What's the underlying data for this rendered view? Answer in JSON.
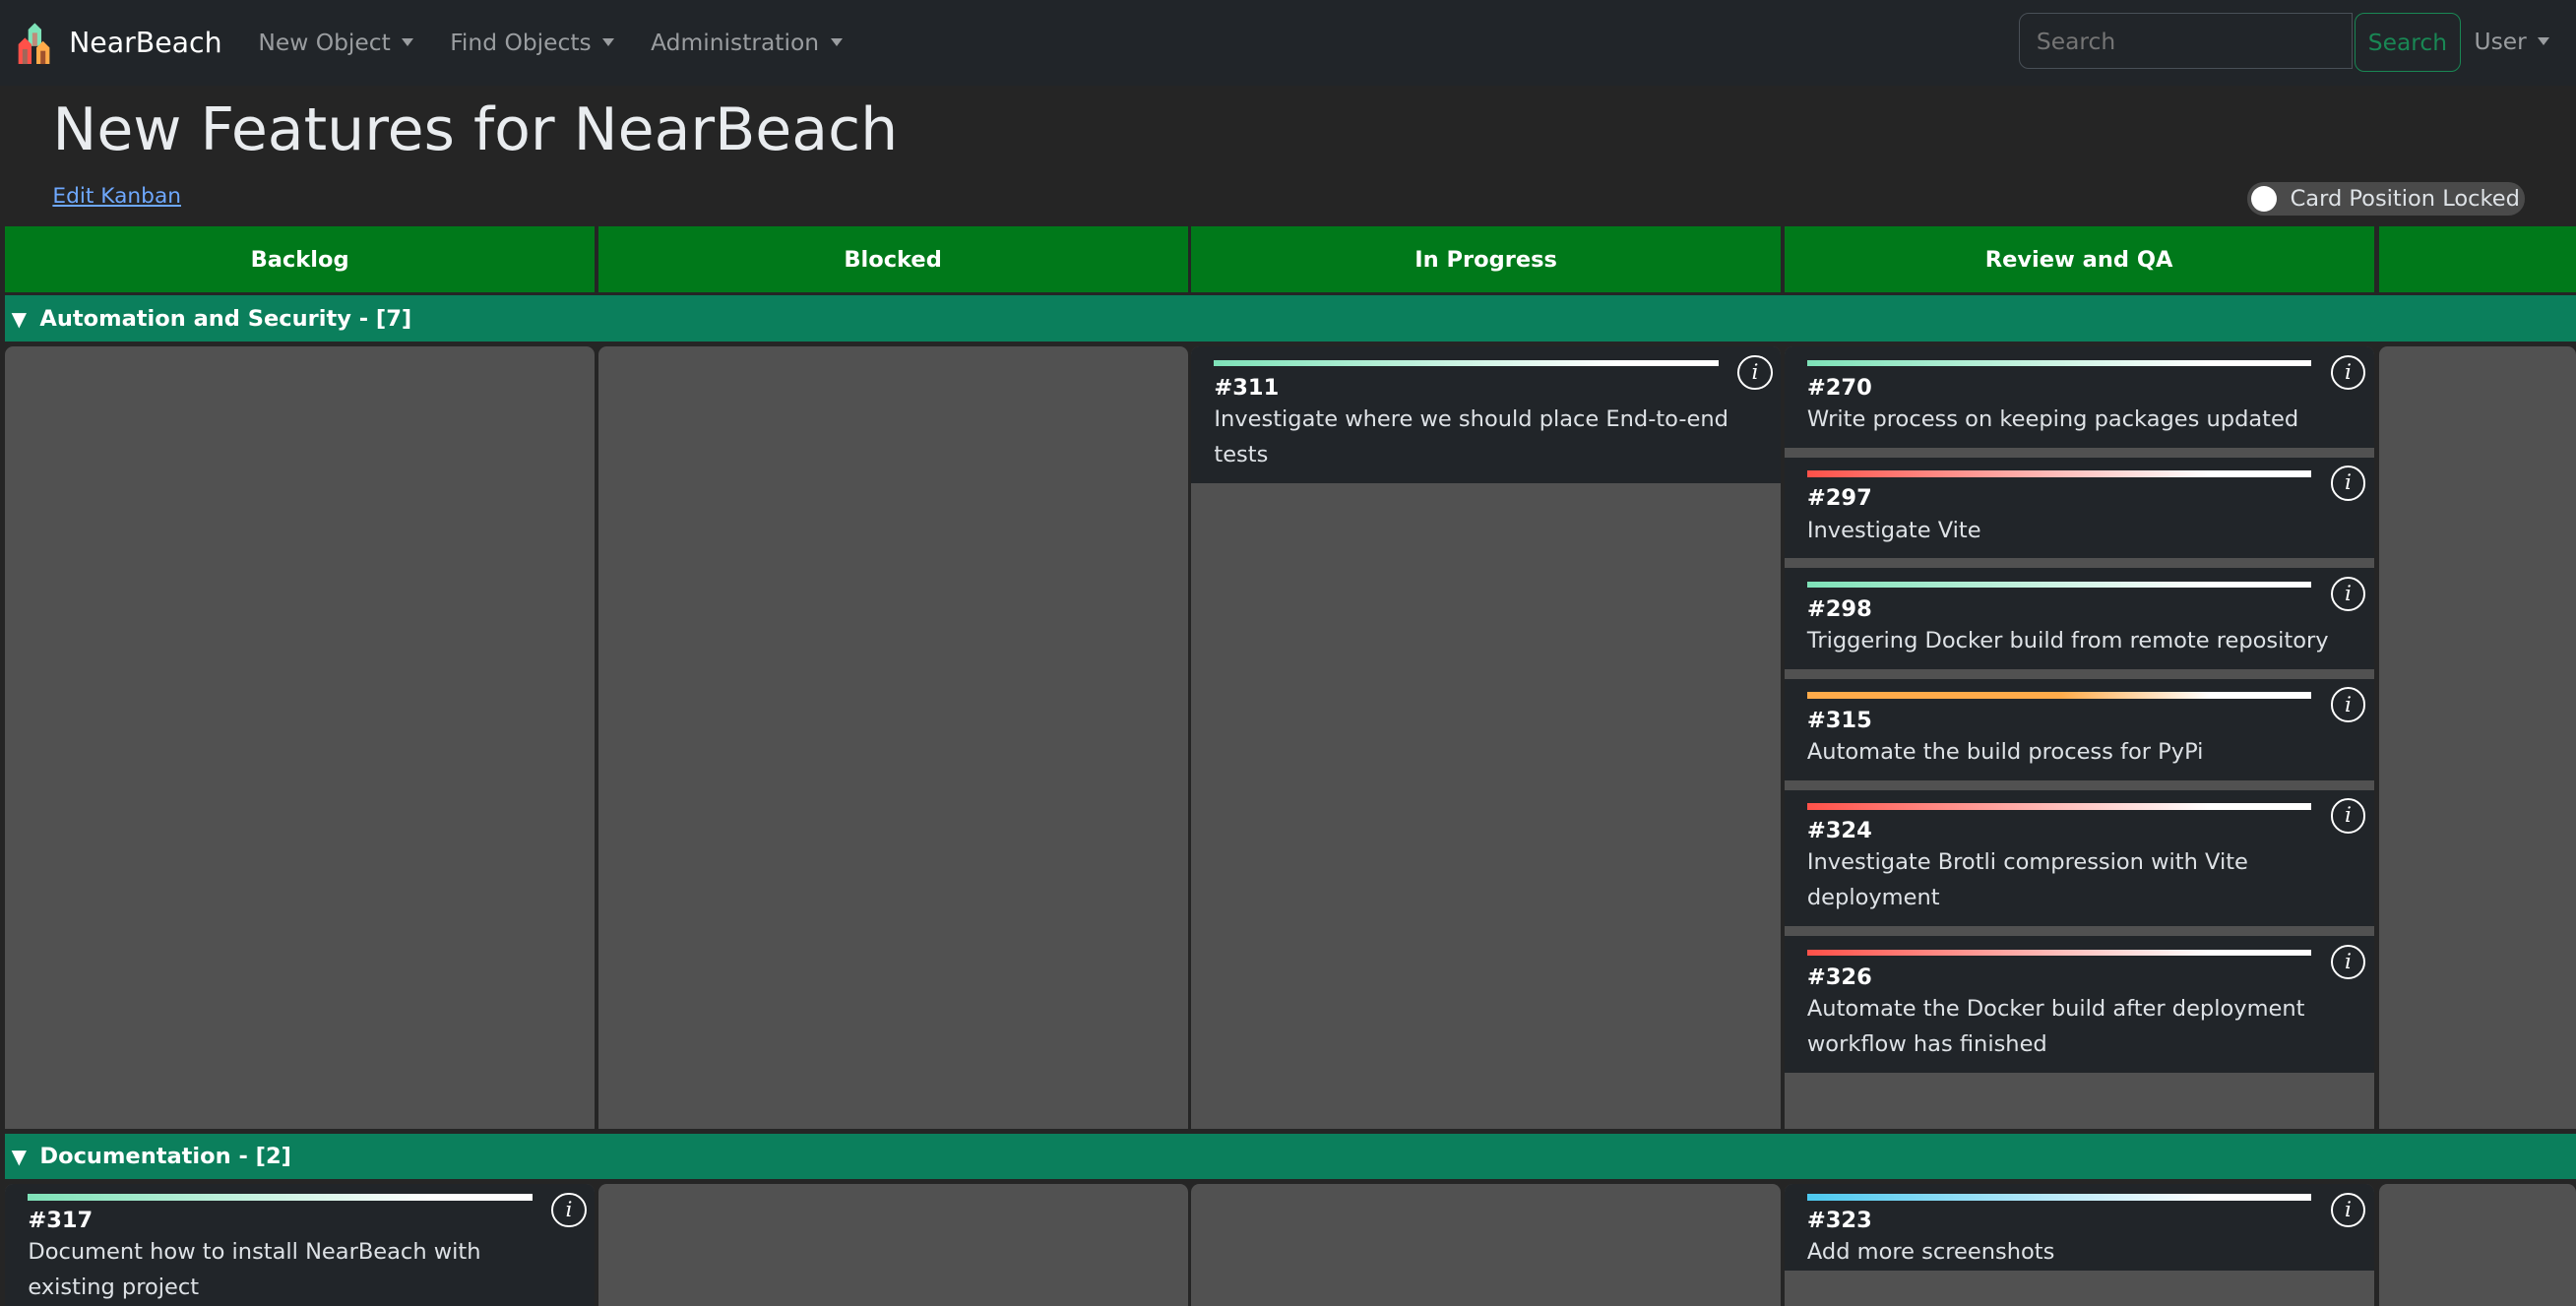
{
  "nav": {
    "brand": "NearBeach",
    "items": [
      "New Object",
      "Find Objects",
      "Administration"
    ],
    "search_placeholder": "Search",
    "search_button": "Search",
    "user": "User"
  },
  "page": {
    "title": "New Features for NearBeach",
    "edit_link": "Edit Kanban",
    "toggle_label": "Card Position Locked",
    "toggle_on": false
  },
  "columns": [
    "Backlog",
    "Blocked",
    "In Progress",
    "Review and QA",
    ""
  ],
  "colors": {
    "header": "#00791a",
    "group": "#0b7f5c",
    "high": "#ff5149",
    "normal": "#7ee2b8",
    "medium": "#ffab4a",
    "low": "#4cc9f0"
  },
  "groups": [
    {
      "label": "Automation and Security - [7]",
      "cells": [
        [],
        [],
        [
          {
            "num": "#311",
            "title": "Investigate where we should place End-to-end tests",
            "priority": "normal"
          }
        ],
        [
          {
            "num": "#270",
            "title": "Write process on keeping packages updated",
            "priority": "normal"
          },
          {
            "num": "#297",
            "title": "Investigate Vite",
            "priority": "high"
          },
          {
            "num": "#298",
            "title": "Triggering Docker build from remote repository",
            "priority": "normal"
          },
          {
            "num": "#315",
            "title": "Automate the build process for PyPi",
            "priority": "medium"
          },
          {
            "num": "#324",
            "title": "Investigate Brotli compression with Vite deployment",
            "priority": "high"
          },
          {
            "num": "#326",
            "title": "Automate the Docker build after deployment workflow has finished",
            "priority": "high"
          }
        ],
        []
      ]
    },
    {
      "label": "Documentation - [2]",
      "cells": [
        [
          {
            "num": "#317",
            "title": "Document how to install NearBeach with existing project",
            "priority": "normal"
          }
        ],
        [],
        [],
        [
          {
            "num": "#323",
            "title": "Add more screenshots",
            "priority": "low"
          }
        ],
        []
      ]
    }
  ]
}
